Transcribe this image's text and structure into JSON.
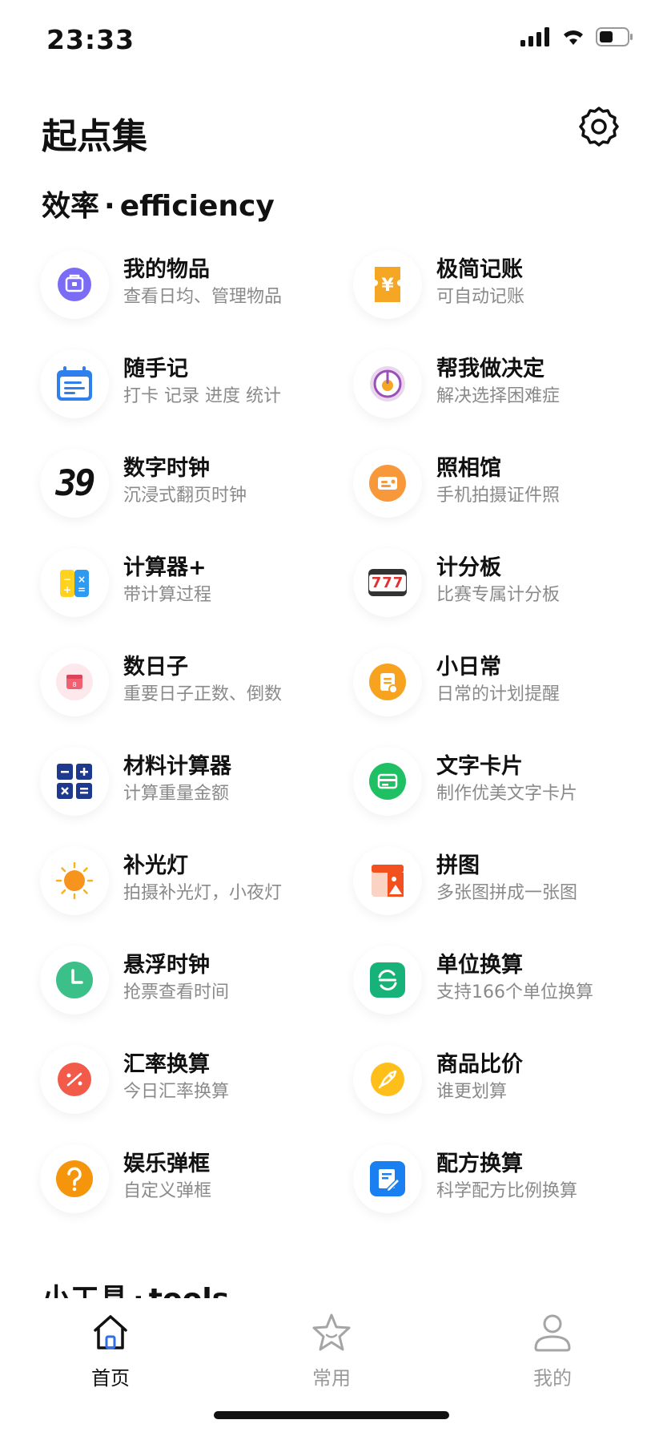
{
  "status": {
    "time": "23:33"
  },
  "header": {
    "title": "起点集"
  },
  "sections": [
    {
      "name": "效率",
      "en": "efficiency"
    },
    {
      "name": "小工具",
      "en": "tools"
    }
  ],
  "items": [
    {
      "title": "我的物品",
      "subtitle": "查看日均、管理物品",
      "icon": "box-icon"
    },
    {
      "title": "极简记账",
      "subtitle": "可自动记账",
      "icon": "yuan-ticket-icon"
    },
    {
      "title": "随手记",
      "subtitle": "打卡 记录 进度 统计",
      "icon": "calendar-note-icon"
    },
    {
      "title": "帮我做决定",
      "subtitle": "解决选择困难症",
      "icon": "spinner-icon"
    },
    {
      "title": "数字时钟",
      "subtitle": "沉浸式翻页时钟",
      "icon": "digital-39-icon",
      "icon_text": "39"
    },
    {
      "title": "照相馆",
      "subtitle": "手机拍摄证件照",
      "icon": "id-card-icon"
    },
    {
      "title": "计算器+",
      "subtitle": "带计算过程",
      "icon": "calculator-color-icon"
    },
    {
      "title": "计分板",
      "subtitle": "比赛专属计分板",
      "icon": "slot-777-icon",
      "icon_text": "777"
    },
    {
      "title": "数日子",
      "subtitle": "重要日子正数、倒数",
      "icon": "calendar-day-icon"
    },
    {
      "title": "小日常",
      "subtitle": "日常的计划提醒",
      "icon": "note-icon"
    },
    {
      "title": "材料计算器",
      "subtitle": "计算重量金额",
      "icon": "calculator-grid-icon"
    },
    {
      "title": "文字卡片",
      "subtitle": "制作优美文字卡片",
      "icon": "card-icon"
    },
    {
      "title": "补光灯",
      "subtitle": "拍摄补光灯，小夜灯",
      "icon": "sun-icon"
    },
    {
      "title": "拼图",
      "subtitle": "多张图拼成一张图",
      "icon": "collage-icon"
    },
    {
      "title": "悬浮时钟",
      "subtitle": "抢票查看时间",
      "icon": "clock-icon"
    },
    {
      "title": "单位换算",
      "subtitle": "支持166个单位换算",
      "icon": "convert-icon"
    },
    {
      "title": "汇率换算",
      "subtitle": "今日汇率换算",
      "icon": "percent-icon"
    },
    {
      "title": "商品比价",
      "subtitle": "谁更划算",
      "icon": "rocket-icon"
    },
    {
      "title": "娱乐弹框",
      "subtitle": "自定义弹框",
      "icon": "question-icon"
    },
    {
      "title": "配方换算",
      "subtitle": "科学配方比例换算",
      "icon": "formula-icon"
    }
  ],
  "tabs": [
    {
      "label": "首页",
      "icon": "home-icon",
      "active": true
    },
    {
      "label": "常用",
      "icon": "star-icon",
      "active": false
    },
    {
      "label": "我的",
      "icon": "user-icon",
      "active": false
    }
  ],
  "colors": {
    "purple": "#7b6cf6",
    "orange": "#f5a623",
    "blue": "#2f80ed",
    "green": "#1fbf63",
    "teal": "#3cc08a",
    "red": "#f25b4a",
    "yellow": "#ffbf1a"
  }
}
